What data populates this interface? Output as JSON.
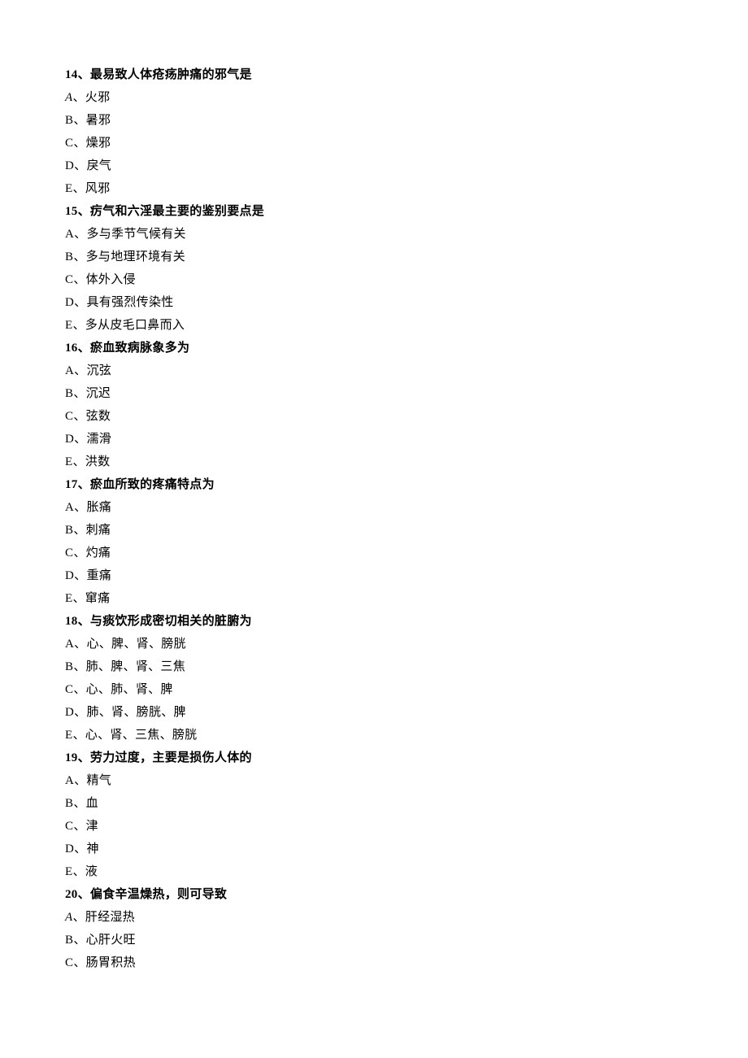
{
  "questions": [
    {
      "number": "14",
      "stem": "最易致人体疮疡肿痛的邪气是",
      "options": [
        {
          "letter": "A",
          "italic": true,
          "text": "火邪"
        },
        {
          "letter": "B",
          "italic": false,
          "text": "暑邪"
        },
        {
          "letter": "C",
          "italic": false,
          "text": "燥邪"
        },
        {
          "letter": "D",
          "italic": false,
          "text": "戾气"
        },
        {
          "letter": "E",
          "italic": false,
          "text": "风邪"
        }
      ]
    },
    {
      "number": "15",
      "stem": "疠气和六淫最主要的鉴别要点是",
      "options": [
        {
          "letter": "A",
          "italic": false,
          "text": "多与季节气候有关"
        },
        {
          "letter": "B",
          "italic": false,
          "text": "多与地理环境有关"
        },
        {
          "letter": "C",
          "italic": false,
          "text": "体外入侵"
        },
        {
          "letter": "D",
          "italic": false,
          "text": "具有强烈传染性"
        },
        {
          "letter": "E",
          "italic": false,
          "text": "多从皮毛口鼻而入"
        }
      ]
    },
    {
      "number": "16",
      "stem": "瘀血致病脉象多为",
      "options": [
        {
          "letter": "A",
          "italic": false,
          "text": "沉弦"
        },
        {
          "letter": "B",
          "italic": false,
          "text": "沉迟"
        },
        {
          "letter": "C",
          "italic": false,
          "text": "弦数"
        },
        {
          "letter": "D",
          "italic": false,
          "text": "濡滑"
        },
        {
          "letter": "E",
          "italic": false,
          "text": "洪数"
        }
      ]
    },
    {
      "number": "17",
      "stem": "瘀血所致的疼痛特点为",
      "options": [
        {
          "letter": "A",
          "italic": false,
          "text": "胀痛"
        },
        {
          "letter": "B",
          "italic": false,
          "text": "刺痛"
        },
        {
          "letter": "C",
          "italic": false,
          "text": "灼痛"
        },
        {
          "letter": "D",
          "italic": false,
          "text": "重痛"
        },
        {
          "letter": "E",
          "italic": false,
          "text": "窜痛"
        }
      ]
    },
    {
      "number": "18",
      "stem": "与痰饮形成密切相关的脏腑为",
      "options": [
        {
          "letter": "A",
          "italic": false,
          "text": "心、脾、肾、膀胱"
        },
        {
          "letter": "B",
          "italic": false,
          "text": "肺、脾、肾、三焦"
        },
        {
          "letter": "C",
          "italic": false,
          "text": "心、肺、肾、脾"
        },
        {
          "letter": "D",
          "italic": false,
          "text": "肺、肾、膀胱、脾"
        },
        {
          "letter": "E",
          "italic": false,
          "text": "心、肾、三焦、膀胱"
        }
      ]
    },
    {
      "number": "19",
      "stem": "劳力过度，主要是损伤人体的",
      "options": [
        {
          "letter": "A",
          "italic": false,
          "text": "精气"
        },
        {
          "letter": "B",
          "italic": false,
          "text": "血"
        },
        {
          "letter": "C",
          "italic": false,
          "text": "津"
        },
        {
          "letter": "D",
          "italic": false,
          "text": "神"
        },
        {
          "letter": "E",
          "italic": false,
          "text": "液"
        }
      ]
    },
    {
      "number": "20",
      "stem": "偏食辛温燥热，则可导致",
      "options": [
        {
          "letter": "A",
          "italic": true,
          "text": "肝经湿热"
        },
        {
          "letter": "B",
          "italic": false,
          "text": "心肝火旺"
        },
        {
          "letter": "C",
          "italic": false,
          "text": "肠胃积热"
        }
      ]
    }
  ],
  "separators": {
    "stem": "、",
    "option": "、"
  }
}
